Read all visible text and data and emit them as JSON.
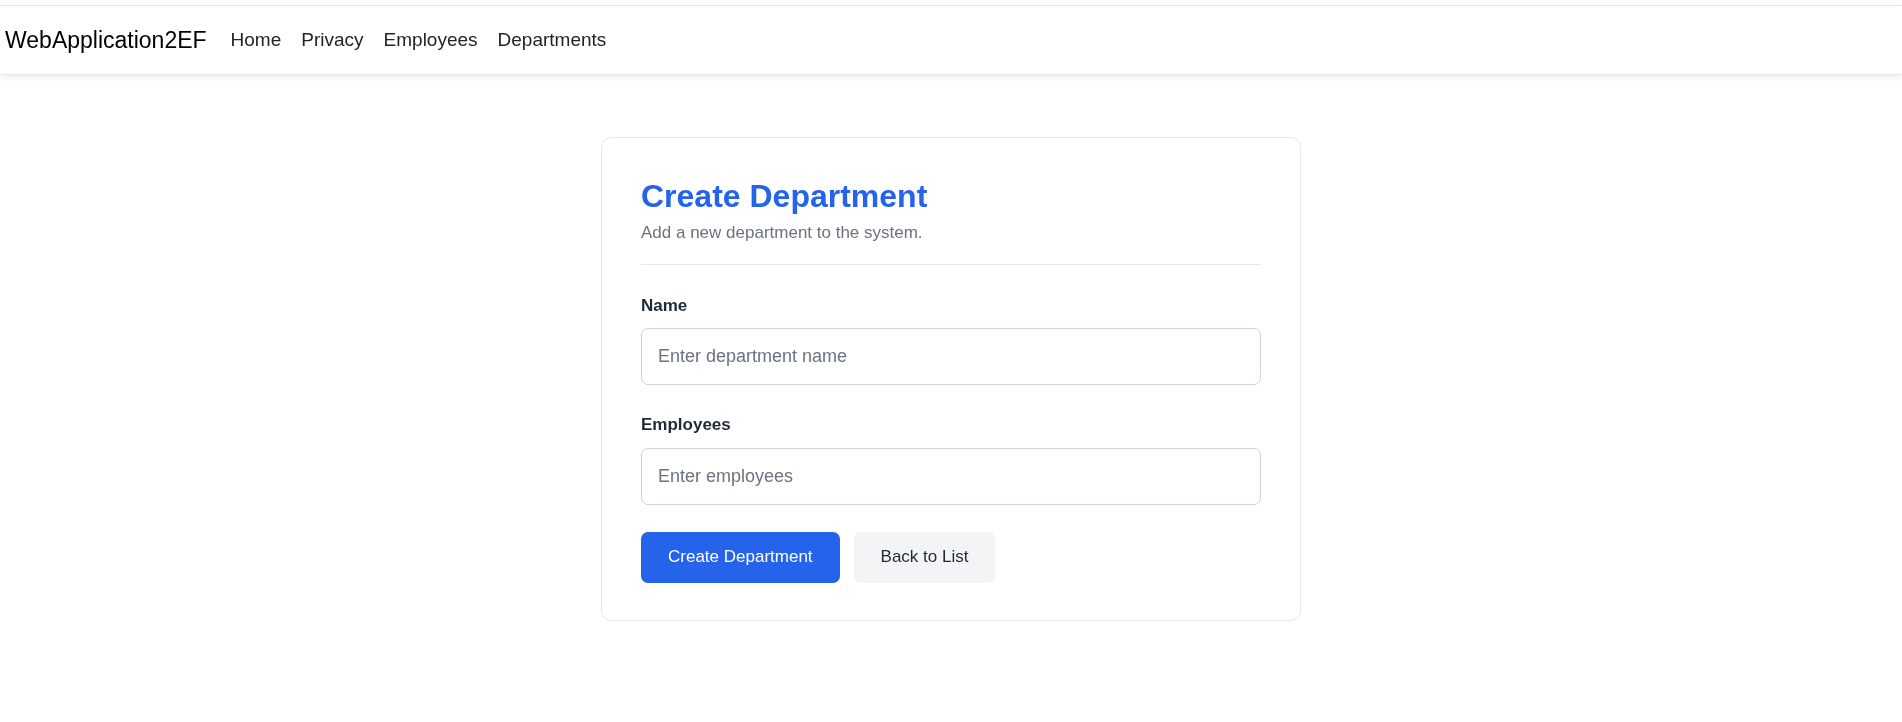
{
  "navbar": {
    "brand": "WebApplication2EF",
    "links": [
      "Home",
      "Privacy",
      "Employees",
      "Departments"
    ]
  },
  "form": {
    "title": "Create Department",
    "subtitle": "Add a new department to the system.",
    "fields": [
      {
        "label": "Name",
        "placeholder": "Enter department name"
      },
      {
        "label": "Employees",
        "placeholder": "Enter employees"
      }
    ],
    "buttons": [
      {
        "kind": "primary",
        "label": "Create Department"
      },
      {
        "kind": "secondary",
        "label": "Back to List"
      }
    ]
  }
}
